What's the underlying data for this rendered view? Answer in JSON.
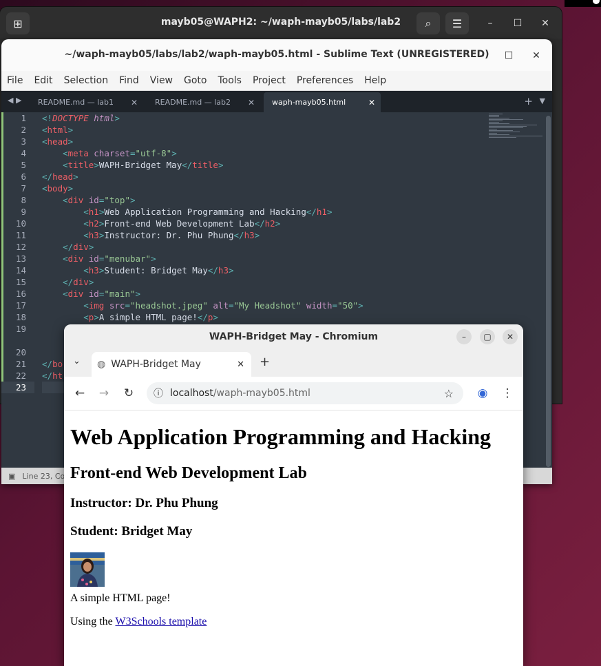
{
  "terminal": {
    "title": "mayb05@WAPH2: ~/waph-mayb05/labs/lab2"
  },
  "sublime": {
    "title": "~/waph-mayb05/labs/lab2/waph-mayb05.html - Sublime Text (UNREGISTERED)",
    "menu": [
      "File",
      "Edit",
      "Selection",
      "Find",
      "View",
      "Goto",
      "Tools",
      "Project",
      "Preferences",
      "Help"
    ],
    "tabs": [
      {
        "label": "README.md — lab1"
      },
      {
        "label": "README.md — lab2"
      },
      {
        "label": "waph-mayb05.html"
      }
    ],
    "line_numbers": [
      "1",
      "2",
      "3",
      "4",
      "5",
      "6",
      "7",
      "8",
      "9",
      "10",
      "11",
      "12",
      "13",
      "14",
      "15",
      "16",
      "17",
      "18",
      "19",
      "",
      "20",
      "21",
      "22",
      "23"
    ],
    "status": "Line 23, Co"
  },
  "chromium": {
    "title": "WAPH-Bridget May - Chromium",
    "tab_label": "WAPH-Bridget May",
    "url_host": "localhost",
    "url_path": "/waph-mayb05.html",
    "page": {
      "h1": "Web Application Programming and Hacking",
      "h2": "Front-end Web Development Lab",
      "instructor": "Instructor: Dr. Phu Phung",
      "student": "Student: Bridget May",
      "image_alt": "My Headshot",
      "p1": "A simple HTML page!",
      "using_prefix": "Using the ",
      "link_text": "W3Schools template"
    }
  }
}
